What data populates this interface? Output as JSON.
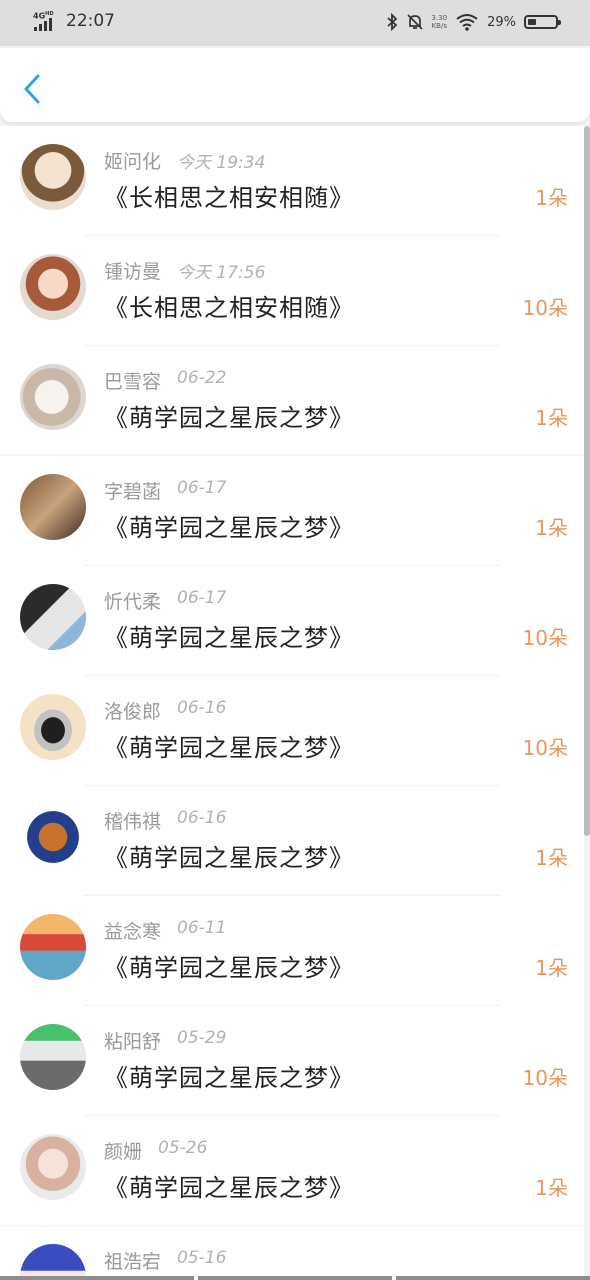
{
  "status_bar": {
    "network": "4G",
    "network_sup": "HD",
    "time": "22:07",
    "speed_value": "3.30",
    "speed_unit": "KB/s",
    "battery_percent": "29%",
    "battery_level": 0.29,
    "icons": [
      "signal-icon",
      "bluetooth-icon",
      "mute-icon",
      "wifi-icon",
      "battery-icon"
    ]
  },
  "header": {
    "back_icon": "chevron-left-icon",
    "accent": "#2aa7e8"
  },
  "colors": {
    "name": "#9a9a9a",
    "date": "#b2b2b2",
    "title": "#222222",
    "count": "#e8965a"
  },
  "items": [
    {
      "name": "姬问化",
      "date": "今天 19:34",
      "title": "《长相思之相安相随》",
      "count": "1朵"
    },
    {
      "name": "锺访曼",
      "date": "今天 17:56",
      "title": "《长相思之相安相随》",
      "count": "10朵"
    },
    {
      "name": "巴雪容",
      "date": "06-22",
      "title": "《萌学园之星辰之梦》",
      "count": "1朵"
    },
    {
      "name": "字碧菡",
      "date": "06-17",
      "title": "《萌学园之星辰之梦》",
      "count": "1朵"
    },
    {
      "name": "忻代柔",
      "date": "06-17",
      "title": "《萌学园之星辰之梦》",
      "count": "10朵"
    },
    {
      "name": "洛俊郎",
      "date": "06-16",
      "title": "《萌学园之星辰之梦》",
      "count": "10朵"
    },
    {
      "name": "稽伟祺",
      "date": "06-16",
      "title": "《萌学园之星辰之梦》",
      "count": "1朵"
    },
    {
      "name": "益念寒",
      "date": "06-11",
      "title": "《萌学园之星辰之梦》",
      "count": "1朵"
    },
    {
      "name": "粘阳舒",
      "date": "05-29",
      "title": "《萌学园之星辰之梦》",
      "count": "10朵"
    },
    {
      "name": "颜姗",
      "date": "05-26",
      "title": "《萌学园之星辰之梦》",
      "count": "1朵"
    },
    {
      "name": "祖浩宕",
      "date": "05-16",
      "title": "",
      "count": ""
    }
  ]
}
